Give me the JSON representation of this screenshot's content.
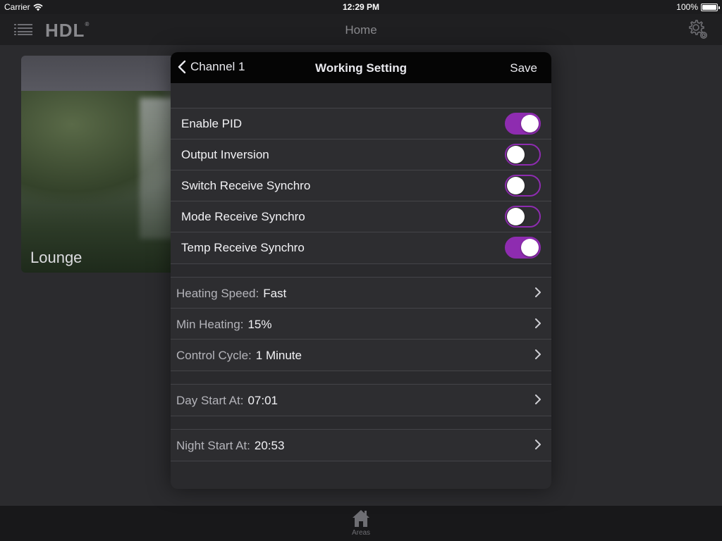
{
  "status_bar": {
    "carrier": "Carrier",
    "time": "12:29 PM",
    "battery": "100%"
  },
  "app_bar": {
    "logo": "HDL",
    "logo_mark": "®",
    "title": "Home"
  },
  "area_card": {
    "label": "Lounge"
  },
  "tab_bar": {
    "areas_label": "Areas"
  },
  "modal": {
    "back_label": "Channel 1",
    "title": "Working Setting",
    "save_label": "Save",
    "toggles": [
      {
        "label": "Enable PID",
        "on": true
      },
      {
        "label": "Output Inversion",
        "on": false
      },
      {
        "label": "Switch Receive Synchro",
        "on": false
      },
      {
        "label": "Mode Receive Synchro",
        "on": false
      },
      {
        "label": "Temp Receive Synchro",
        "on": true
      }
    ],
    "settings": [
      {
        "key": "Heating Speed:",
        "value": "Fast"
      },
      {
        "key": "Min Heating:",
        "value": "15%"
      },
      {
        "key": "Control Cycle:",
        "value": "1 Minute"
      }
    ],
    "day_start": {
      "key": "Day Start At:",
      "value": "07:01"
    },
    "night_start": {
      "key": "Night Start At:",
      "value": "20:53"
    }
  },
  "colors": {
    "accent": "#8e2cb0",
    "header_bg": "#050505",
    "row_bg": "#2d2d30"
  }
}
